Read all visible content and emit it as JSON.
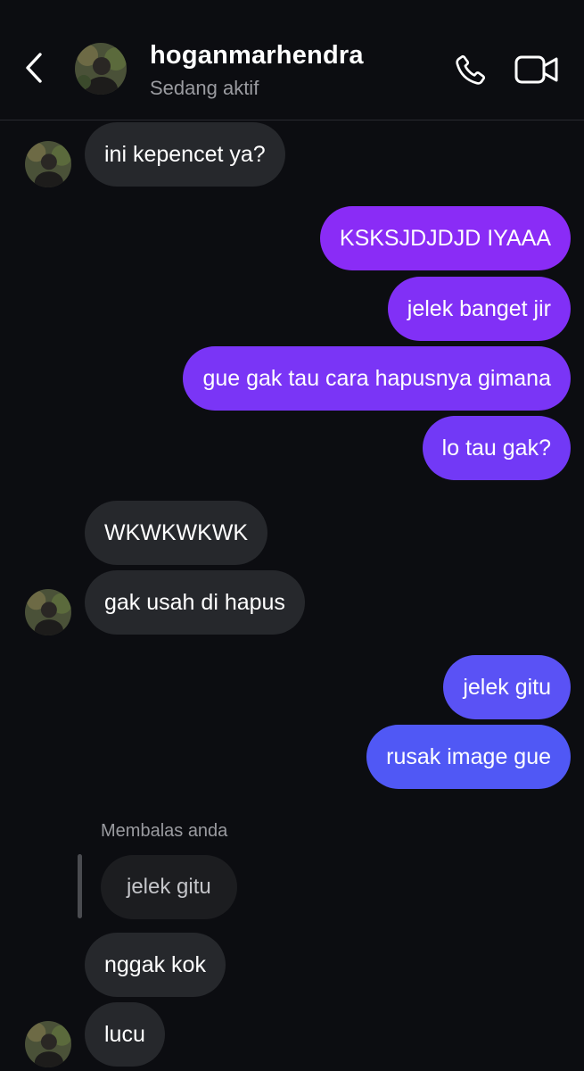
{
  "header": {
    "username": "hoganmarhendra",
    "status": "Sedang aktif",
    "back_icon": "chevron-left-icon",
    "call_icon": "phone-icon",
    "video_icon": "video-camera-icon"
  },
  "colors": {
    "background": "#0c0d11",
    "received_bubble": "#26282c",
    "sent_purple": "#7b2ff7",
    "sent_blue": "#5555f5",
    "reply_quote_bg": "#1c1d20",
    "secondary_text": "#9a9ba0"
  },
  "messages": {
    "m1": "ini kepencet ya?",
    "m2": "KSKSJDJDJD IYAAA",
    "m3": "jelek banget jir",
    "m4": "gue gak tau cara hapusnya gimana",
    "m5": "lo tau gak?",
    "m6": "WKWKWKWK",
    "m7": "gak usah di hapus",
    "m8": "jelek gitu",
    "m9": "rusak image gue",
    "reply_label": "Membalas anda",
    "reply_quote": "jelek gitu",
    "m10": "nggak kok",
    "m11": "lucu"
  }
}
